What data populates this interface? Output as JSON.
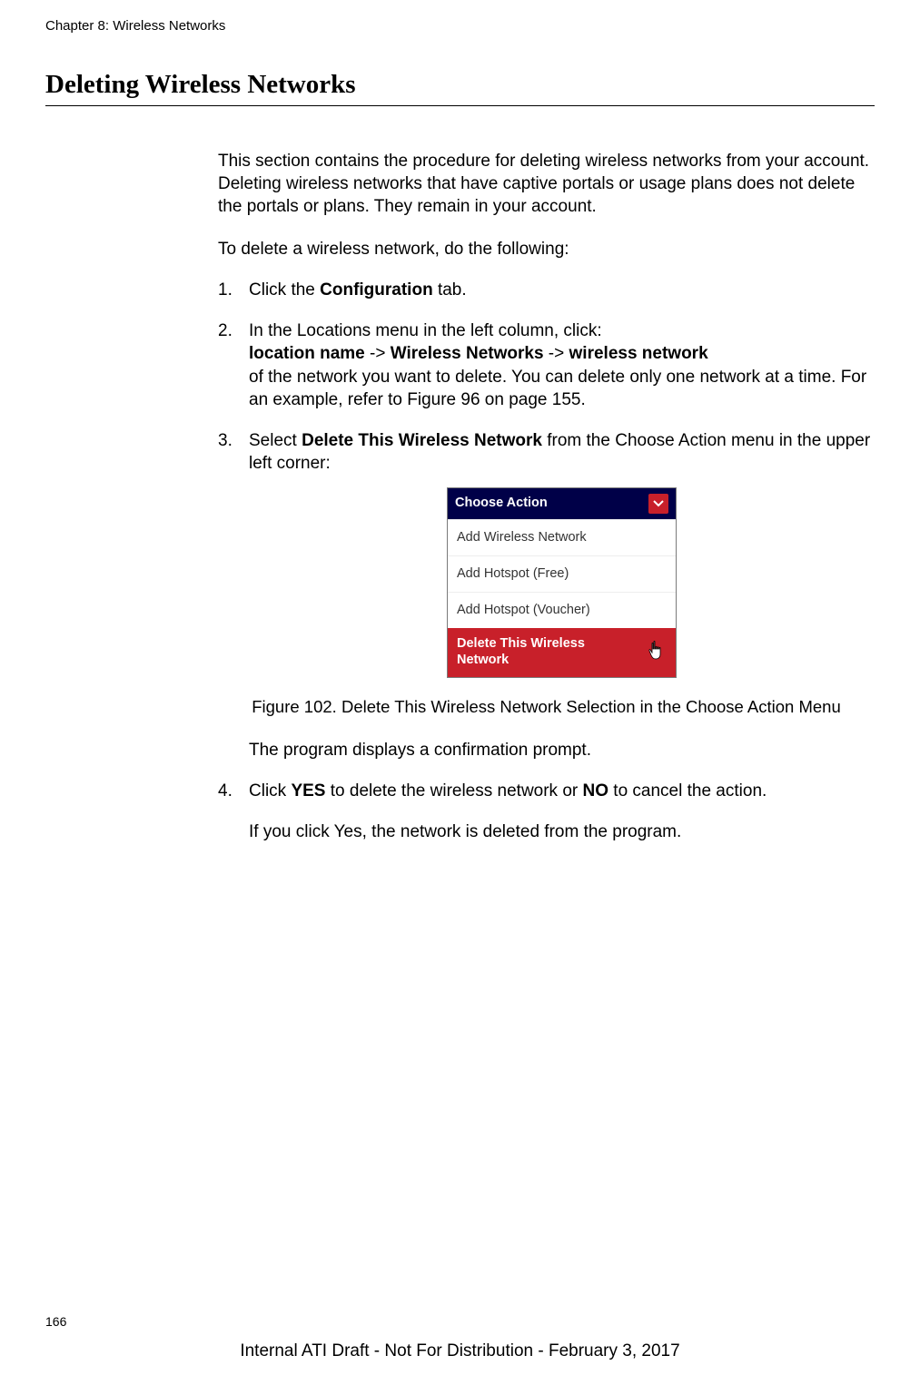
{
  "header": "Chapter 8: Wireless Networks",
  "section_title": "Deleting Wireless Networks",
  "intro": "This section contains the procedure for deleting wireless networks from your account. Deleting wireless networks that have captive portals or usage plans does not delete the portals or plans. They remain in your account.",
  "lead_in": "To delete a wireless network, do the following:",
  "steps": {
    "s1_pre": "Click the ",
    "s1_bold": "Configuration",
    "s1_post": " tab.",
    "s2_line1": "In the Locations menu in the left column, click:",
    "s2_b1": "location name",
    "s2_arrow": " -> ",
    "s2_b2": "Wireless Networks",
    "s2_b3": "wireless network",
    "s2_tail": "of the network you want to delete. You can delete only one network at a time. For an example, refer to Figure 96 on page 155.",
    "s3_pre": "Select ",
    "s3_bold": "Delete This Wireless Network",
    "s3_post": " from the Choose Action menu in the upper left corner:",
    "s3_result": "The program displays a confirmation prompt.",
    "s4_pre": "Click ",
    "s4_b1": "YES",
    "s4_mid": " to delete the wireless network or ",
    "s4_b2": "NO",
    "s4_post": " to cancel the action.",
    "s4_result": "If you click Yes, the network is deleted from the program."
  },
  "choose_action": {
    "header": "Choose Action",
    "items": [
      "Add Wireless Network",
      "Add Hotspot (Free)",
      "Add Hotspot (Voucher)"
    ],
    "delete": "Delete This Wireless Network"
  },
  "figure_caption": "Figure 102. Delete This Wireless Network Selection in the Choose Action Menu",
  "page_number": "166",
  "footer": "Internal ATI Draft - Not For Distribution - February 3, 2017"
}
